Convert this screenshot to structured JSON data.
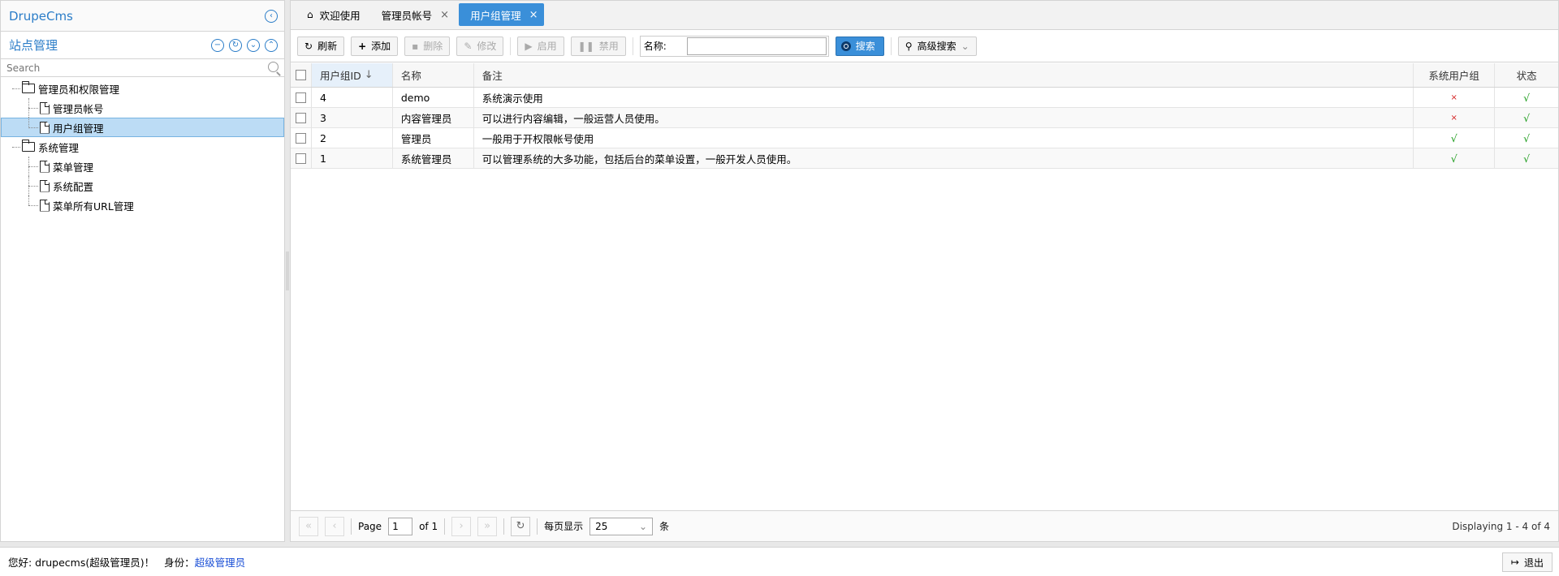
{
  "app": {
    "title": "DrupeCms",
    "collapse_icon": "chevron-left-circle-icon"
  },
  "sidebar": {
    "section_title": "站点管理",
    "tool_icons": [
      "collapse-all-icon",
      "refresh-icon",
      "expand-icon",
      "collapse-icon"
    ],
    "search": {
      "placeholder": "Search"
    },
    "tree": [
      {
        "label": "管理员和权限管理",
        "type": "folder",
        "level": 0
      },
      {
        "label": "管理员帐号",
        "type": "file",
        "level": 1
      },
      {
        "label": "用户组管理",
        "type": "file",
        "level": 1,
        "selected": true
      },
      {
        "label": "系统管理",
        "type": "folder",
        "level": 0
      },
      {
        "label": "菜单管理",
        "type": "file",
        "level": 1
      },
      {
        "label": "系统配置",
        "type": "file",
        "level": 1
      },
      {
        "label": "菜单所有URL管理",
        "type": "file",
        "level": 1
      }
    ]
  },
  "tabs": [
    {
      "label": "欢迎使用",
      "icon": "home-icon",
      "closable": false
    },
    {
      "label": "管理员帐号",
      "closable": true
    },
    {
      "label": "用户组管理",
      "closable": true,
      "active": true
    }
  ],
  "toolbar": {
    "refresh_label": "刷新",
    "add_label": "添加",
    "delete_label": "删除",
    "edit_label": "修改",
    "enable_label": "启用",
    "disable_label": "禁用",
    "name_label": "名称:",
    "name_value": "",
    "search_label": "搜索",
    "advanced_label": "高级搜索"
  },
  "grid": {
    "columns": [
      "用户组ID",
      "名称",
      "备注",
      "系统用户组",
      "状态"
    ],
    "rows": [
      {
        "id": "4",
        "name": "demo",
        "remark": "系统演示使用",
        "system": "×",
        "status": "√"
      },
      {
        "id": "3",
        "name": "内容管理员",
        "remark": "可以进行内容编辑，一般运营人员使用。",
        "system": "×",
        "status": "√"
      },
      {
        "id": "2",
        "name": "管理员",
        "remark": "一般用于开权限帐号使用",
        "system": "√",
        "status": "√"
      },
      {
        "id": "1",
        "name": "系统管理员",
        "remark": "可以管理系统的大多功能，包括后台的菜单设置，一般开发人员使用。",
        "system": "√",
        "status": "√"
      }
    ]
  },
  "pager": {
    "page_label": "Page",
    "page_value": "1",
    "of_label": "of 1",
    "per_page_label": "每页显示",
    "per_page_value": "25",
    "unit_label": "条",
    "display_text": "Displaying 1 - 4 of 4"
  },
  "footer": {
    "greeting": "您好: drupecms(超级管理员)！",
    "identity_label": "身份：",
    "identity_value": "超级管理员",
    "logout_label": "退出"
  },
  "colors": {
    "accent": "#3a8fd9",
    "link": "#1a4fd6",
    "yes": "#1a9b1a",
    "no": "#d42020"
  }
}
